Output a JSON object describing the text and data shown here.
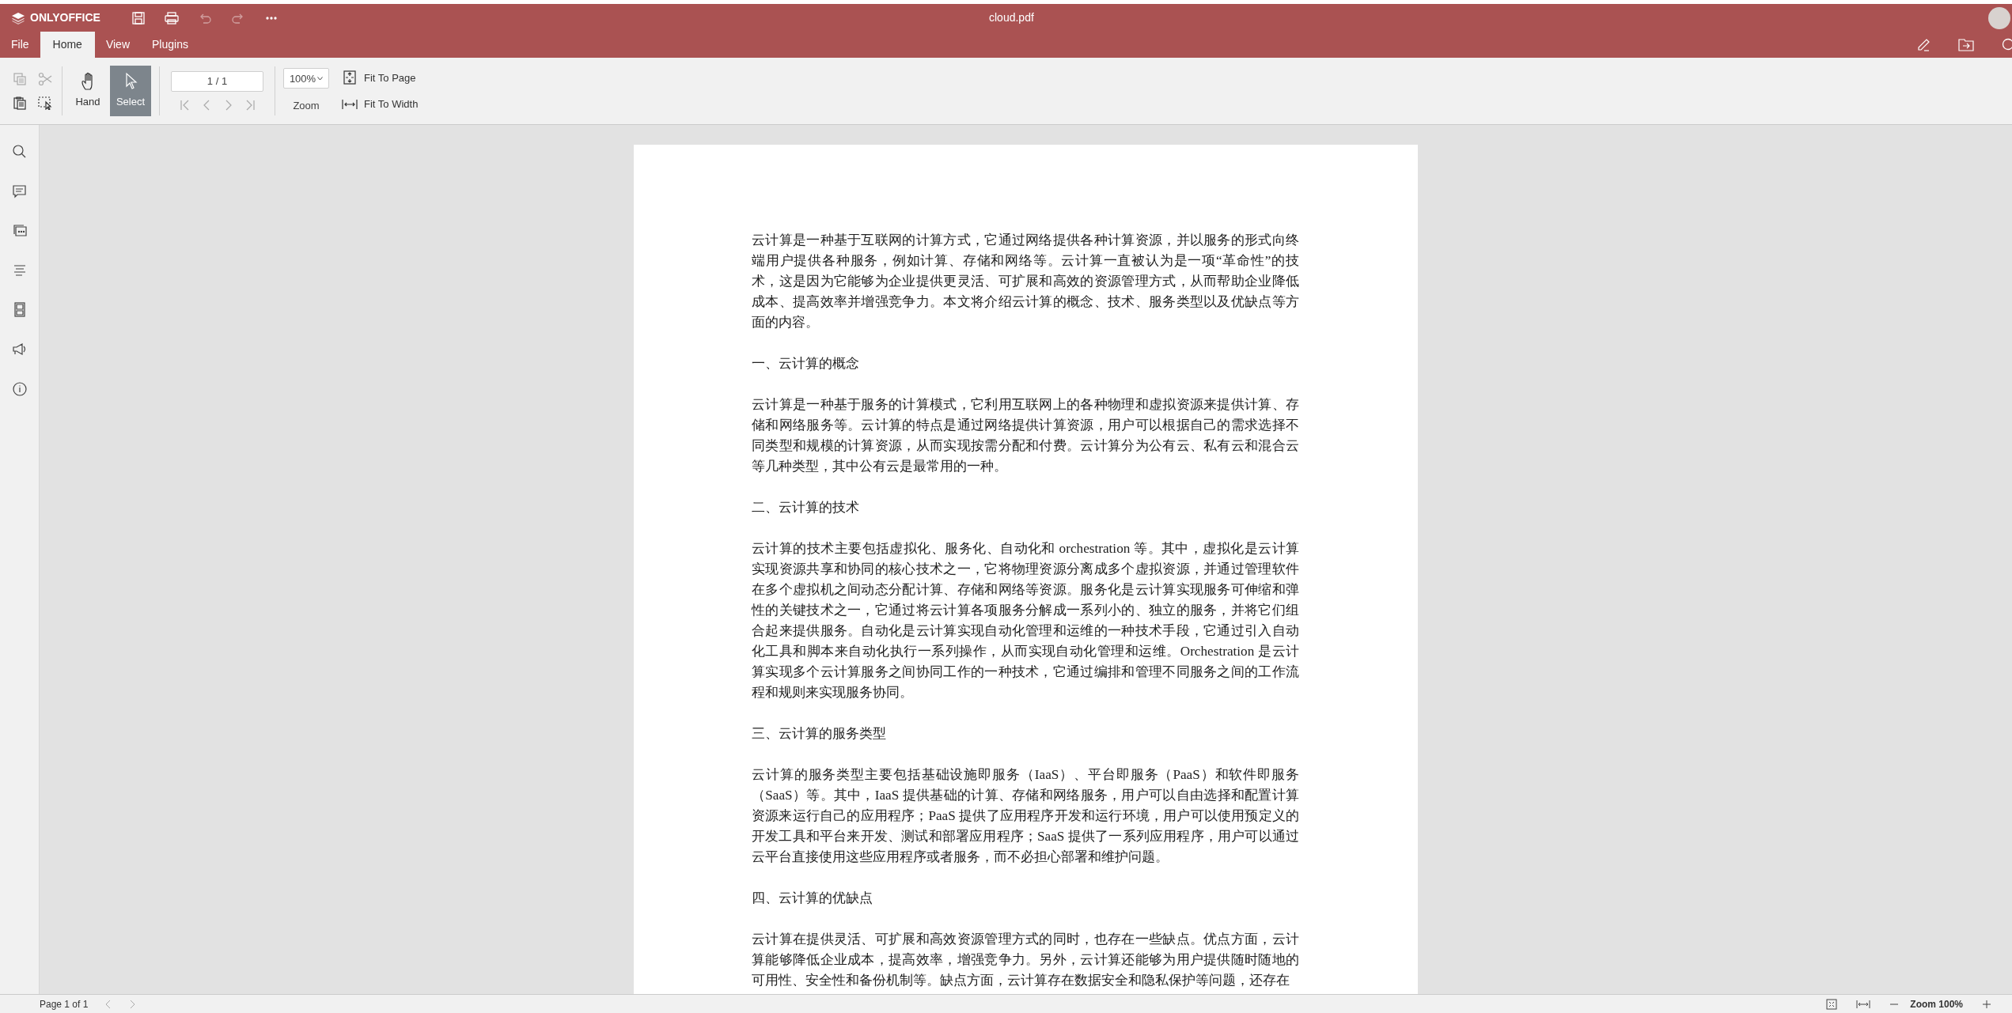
{
  "header": {
    "logo": "ONLYOFFICE",
    "title": "cloud.pdf",
    "quick_actions": [
      {
        "kind": "save",
        "disabled": false
      },
      {
        "kind": "print",
        "disabled": false
      },
      {
        "kind": "undo",
        "disabled": true
      },
      {
        "kind": "redo",
        "disabled": true
      },
      {
        "kind": "more",
        "disabled": false
      }
    ]
  },
  "tabs": [
    {
      "label": "File",
      "selected": false
    },
    {
      "label": "Home",
      "selected": true
    },
    {
      "label": "View",
      "selected": false
    },
    {
      "label": "Plugins",
      "selected": false
    }
  ],
  "toolbar": {
    "clipboard": [
      {
        "kind": "copy",
        "disabled": true
      },
      {
        "kind": "cut",
        "disabled": true
      },
      {
        "kind": "paste",
        "disabled": false
      },
      {
        "kind": "select-all",
        "disabled": false
      }
    ],
    "tools": [
      {
        "kind": "hand",
        "label": "Hand",
        "selected": false
      },
      {
        "kind": "select",
        "label": "Select",
        "selected": true
      }
    ],
    "page_field": {
      "value": "1 / 1"
    },
    "page_nav": [
      {
        "kind": "first",
        "disabled": true
      },
      {
        "kind": "prev",
        "disabled": true
      },
      {
        "kind": "next",
        "disabled": true
      },
      {
        "kind": "last",
        "disabled": true
      }
    ],
    "zoom_select": {
      "value": "100%"
    },
    "zoom_label": "Zoom",
    "fit": [
      {
        "kind": "page",
        "label": "Fit To Page"
      },
      {
        "kind": "width",
        "label": "Fit To Width"
      }
    ]
  },
  "document": [
    {
      "kind": "paragraph",
      "text": "云计算是一种基于互联网的计算方式，它通过网络提供各种计算资源，并以服务的形式向终端用户提供各种服务，例如计算、存储和网络等。云计算一直被认为是一项“革命性”的技术，这是因为它能够为企业提供更灵活、可扩展和高效的资源管理方式，从而帮助企业降低成本、提高效率并增强竞争力。本文将介绍云计算的概念、技术、服务类型以及优缺点等方面的内容。"
    },
    {
      "kind": "heading",
      "text": "一、云计算的概念"
    },
    {
      "kind": "paragraph",
      "text": "云计算是一种基于服务的计算模式，它利用互联网上的各种物理和虚拟资源来提供计算、存储和网络服务等。云计算的特点是通过网络提供计算资源，用户可以根据自己的需求选择不同类型和规模的计算资源，从而实现按需分配和付费。云计算分为公有云、私有云和混合云等几种类型，其中公有云是最常用的一种。"
    },
    {
      "kind": "heading",
      "text": "二、云计算的技术"
    },
    {
      "kind": "paragraph",
      "text": "云计算的技术主要包括虚拟化、服务化、自动化和 orchestration 等。其中，虚拟化是云计算实现资源共享和协同的核心技术之一，它将物理资源分离成多个虚拟资源，并通过管理软件在多个虚拟机之间动态分配计算、存储和网络等资源。服务化是云计算实现服务可伸缩和弹性的关键技术之一，它通过将云计算各项服务分解成一系列小的、独立的服务，并将它们组合起来提供服务。自动化是云计算实现自动化管理和运维的一种技术手段，它通过引入自动化工具和脚本来自动化执行一系列操作，从而实现自动化管理和运维。Orchestration 是云计算实现多个云计算服务之间协同工作的一种技术，它通过编排和管理不同服务之间的工作流程和规则来实现服务协同。"
    },
    {
      "kind": "heading",
      "text": "三、云计算的服务类型"
    },
    {
      "kind": "paragraph",
      "text": "云计算的服务类型主要包括基础设施即服务（IaaS）、平台即服务（PaaS）和软件即服务（SaaS）等。其中，IaaS 提供基础的计算、存储和网络服务，用户可以自由选择和配置计算资源来运行自己的应用程序；PaaS 提供了应用程序开发和运行环境，用户可以使用预定义的开发工具和平台来开发、测试和部署应用程序；SaaS 提供了一系列应用程序，用户可以通过云平台直接使用这些应用程序或者服务，而不必担心部署和维护问题。"
    },
    {
      "kind": "heading",
      "text": "四、云计算的优缺点"
    },
    {
      "kind": "paragraph",
      "text": "云计算在提供灵活、可扩展和高效资源管理方式的同时，也存在一些缺点。优点方面，云计算能够降低企业成本，提高效率，增强竞争力。另外，云计算还能够为用户提供随时随地的可用性、安全性和备份机制等。缺点方面，云计算存在数据安全和隐私保护等问题，还存在"
    }
  ],
  "status_bar": {
    "page_label": "Page 1 of 1",
    "zoom_label": "Zoom 100%"
  }
}
